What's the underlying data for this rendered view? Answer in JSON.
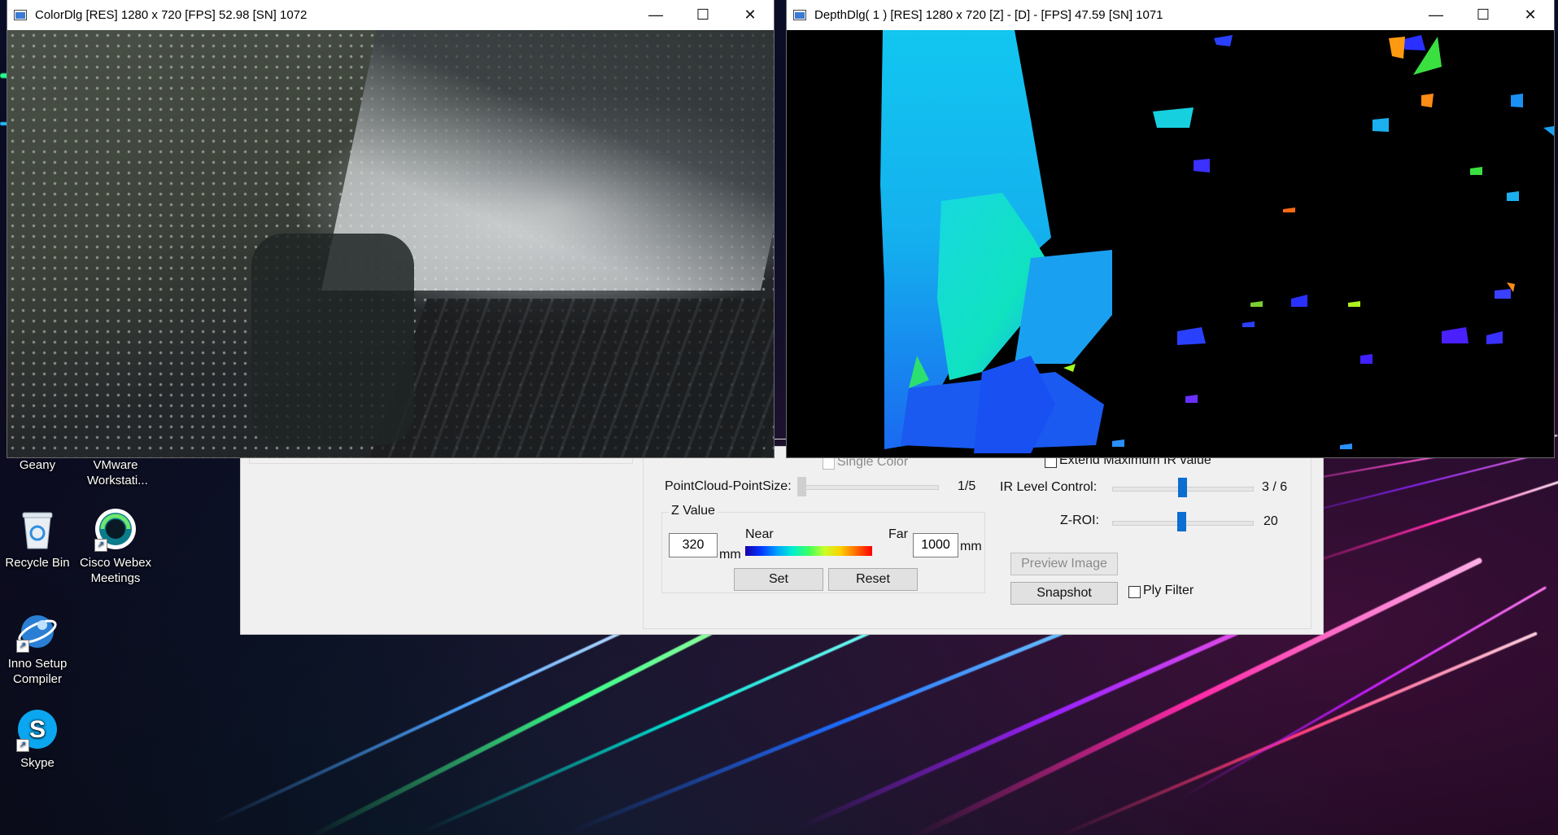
{
  "desktop": {
    "icons": [
      {
        "label": "Geany"
      },
      {
        "label": "VMware Workstati..."
      },
      {
        "label": "Recycle Bin"
      },
      {
        "label": "Cisco Webex Meetings"
      },
      {
        "label": "Inno Setup Compiler"
      },
      {
        "label": "Skype"
      }
    ]
  },
  "color_window": {
    "title": "ColorDlg [RES] 1280 x 720 [FPS] 52.98 [SN] 1072"
  },
  "depth_window": {
    "title": "DepthDlg( 1 ) [RES] 1280 x 720 [Z] -  [D] -   [FPS] 47.59 [SN] 1071"
  },
  "window_controls": {
    "minimize": "—",
    "maximize": "☐",
    "close": "✕"
  },
  "control_panel": {
    "single_color_label": "Single Color",
    "extend_ir_label": "Extend Maximum IR value",
    "pointsize_label": "PointCloud-PointSize:",
    "pointsize_value": "1/5",
    "ir_level_label": "IR Level Control:",
    "ir_level_value": "3 / 6",
    "ir_level_fraction": 0.5,
    "zroi_label": "Z-ROI:",
    "zroi_value": "20",
    "z_value_group": "Z Value",
    "near_label": "Near",
    "far_label": "Far",
    "near_value": "320",
    "far_value": "1000",
    "unit_mm": "mm",
    "set_button": "Set",
    "reset_button": "Reset",
    "preview_button": "Preview Image",
    "snapshot_button": "Snapshot",
    "ply_filter_label": "Ply Filter"
  }
}
